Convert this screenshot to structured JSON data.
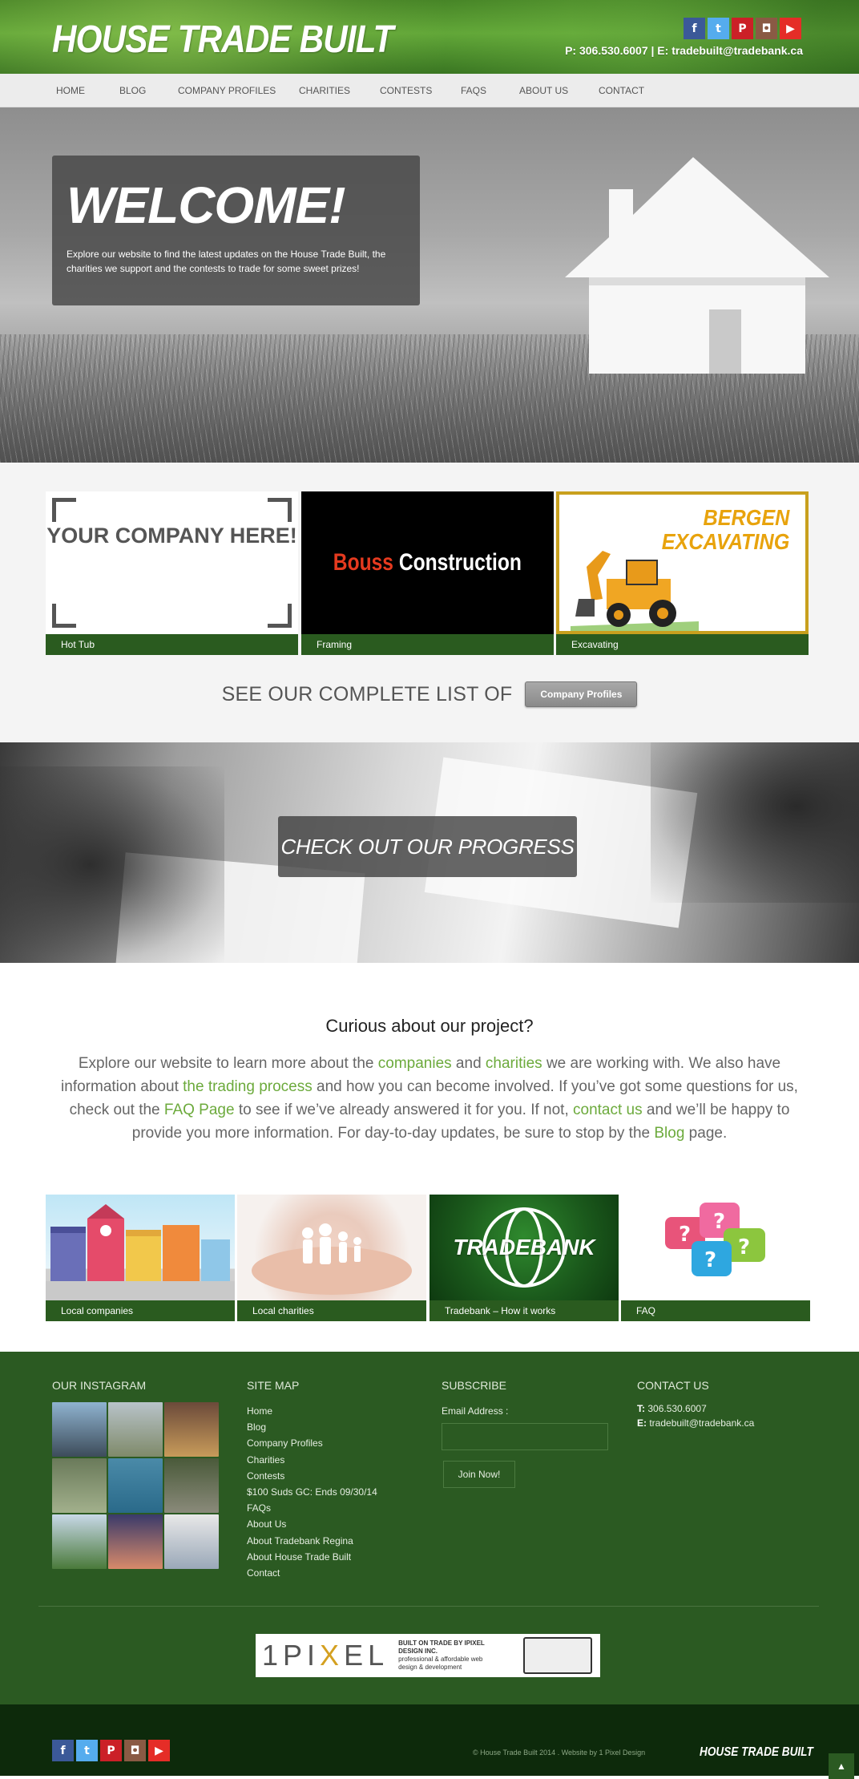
{
  "header": {
    "logo": "HOUSE TRADE BUILT",
    "contact": "P: 306.530.6007 | E: tradebuilt@tradebank.ca",
    "social": [
      "facebook-icon",
      "twitter-icon",
      "pinterest-icon",
      "instagram-icon",
      "youtube-icon"
    ]
  },
  "nav": {
    "items": [
      "HOME",
      "BLOG",
      "COMPANY PROFILES",
      "CHARITIES",
      "CONTESTS",
      "FAQS",
      "ABOUT US",
      "CONTACT"
    ]
  },
  "hero": {
    "title": "WELCOME!",
    "text": "Explore our website to find the latest updates on the House Trade Built, the charities we support and the contests to trade for some sweet prizes!"
  },
  "profiles": {
    "cards": [
      {
        "image_text": "YOUR COMPANY HERE!",
        "caption": "Hot Tub"
      },
      {
        "image_text_red": "Bouss",
        "image_text_white": " Construction",
        "caption": "Framing"
      },
      {
        "image_text_line1": "BERGEN",
        "image_text_line2": "EXCAVATING",
        "caption": "Excavating"
      }
    ],
    "see_text": "SEE OUR COMPLETE LIST OF",
    "button": "Company Profiles"
  },
  "progress": {
    "label": "CHECK OUT OUR PROGRESS"
  },
  "curious": {
    "title": "Curious about our project?",
    "t1": "Explore our website to learn more about the ",
    "l1": "companies",
    "t2": " and ",
    "l2": "charities",
    "t3": " we are working with. We also have information about ",
    "l3": "the trading process",
    "t4": " and how you can become involved. If you’ve got some questions for us, check out the ",
    "l4": "FAQ Page",
    "t5": " to see if we’ve already answered it for you. If not, ",
    "l5": "contact us",
    "t6": " and we’ll be happy to provide you more information. For day-to-day updates, be sure to stop by the ",
    "l6": "Blog",
    "t7": " page."
  },
  "tiles": [
    {
      "caption": "Local companies"
    },
    {
      "caption": "Local charities"
    },
    {
      "caption": "Tradebank – How it works",
      "image_text": "TRADEBANK"
    },
    {
      "caption": "FAQ"
    }
  ],
  "footer": {
    "instagram_title": "OUR INSTAGRAM",
    "sitemap_title": "SITE MAP",
    "sitemap": [
      "Home",
      "Blog",
      "Company Profiles",
      "Charities",
      "Contests",
      "$100 Suds GC: Ends 09/30/14",
      "FAQs",
      "About Us",
      "About Tradebank Regina",
      "About House Trade Built",
      "Contact"
    ],
    "subscribe_title": "SUBSCRIBE",
    "email_label": "Email Address :",
    "join_button": "Join Now!",
    "contact_title": "CONTACT US",
    "phone_label": "T:",
    "phone": "306.530.6007",
    "email_label2": "E:",
    "email": "tradebuilt@tradebank.ca",
    "banner_logo_a": "1PI",
    "banner_logo_x": "X",
    "banner_logo_b": "EL",
    "banner_top": "BUILT ON TRADE BY IPIXEL DESIGN INC.",
    "banner_sub": "professional & affordable web design & development"
  },
  "bottom": {
    "copyright": "© House Trade Built 2014 . Website by 1 Pixel Design",
    "logo": "HOUSE TRADE BUILT",
    "to_top": "▲"
  }
}
